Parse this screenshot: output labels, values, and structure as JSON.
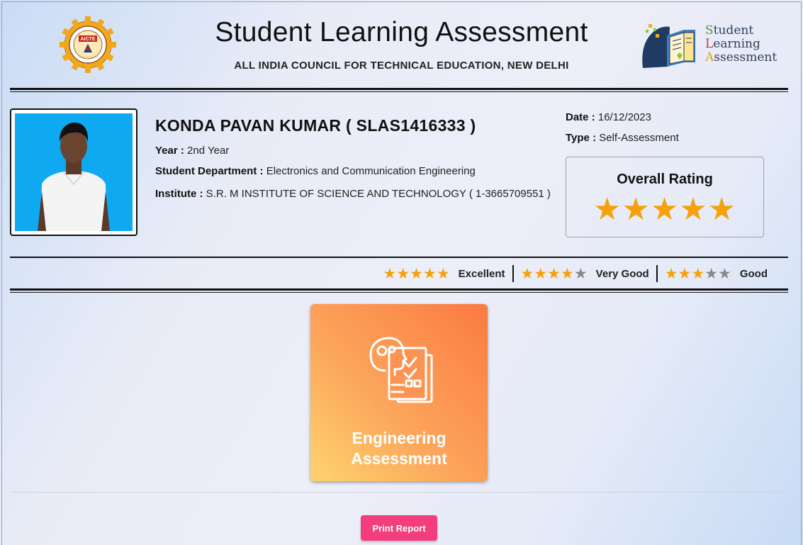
{
  "header": {
    "title": "Student Learning Assessment",
    "subtitle": "ALL INDIA COUNCIL FOR TECHNICAL EDUCATION, NEW DELHI",
    "left_logo": {
      "icon": "aicte-gear-logo",
      "text": "AICTE"
    },
    "right_logo": {
      "icon": "book-head-logo",
      "lines": [
        "Student",
        "Learning",
        "Assessment"
      ]
    }
  },
  "student": {
    "name_line": "KONDA PAVAN KUMAR ( SLAS1416333 )",
    "year_label": "Year :",
    "year_value": "2nd Year",
    "department_label": "Student Department :",
    "department_value": "Electronics and Communication Engineering",
    "institute_label": "Institute :",
    "institute_value": "S.R. M INSTITUTE OF SCIENCE AND TECHNOLOGY ( 1-3665709551 )"
  },
  "meta": {
    "date_label": "Date :",
    "date_value": "16/12/2023",
    "type_label": "Type :",
    "type_value": "Self-Assessment"
  },
  "overall_rating": {
    "title": "Overall Rating",
    "stars_filled": 5,
    "stars_total": 5,
    "stars_display": "★★★★★"
  },
  "legend": [
    {
      "filled": "★★★★★",
      "empty": "",
      "label": "Excellent",
      "stars": 5
    },
    {
      "filled": "★★★★",
      "empty": "★",
      "label": "Very Good",
      "stars": 4
    },
    {
      "filled": "★★★",
      "empty": "★★",
      "label": "Good",
      "stars": 3
    }
  ],
  "assessment_card": {
    "label_line1": "Engineering",
    "label_line2": "Assessment",
    "icon": "brain-checklist-icon"
  },
  "print_button": "Print Report",
  "colors": {
    "star": "#f5a10a",
    "star_off": "#8a8a8a",
    "card_gradient_from": "#fdd36e",
    "card_gradient_to": "#fb7a42",
    "print_button": "#f23e7c",
    "photo_background": "#0fa9f2"
  }
}
